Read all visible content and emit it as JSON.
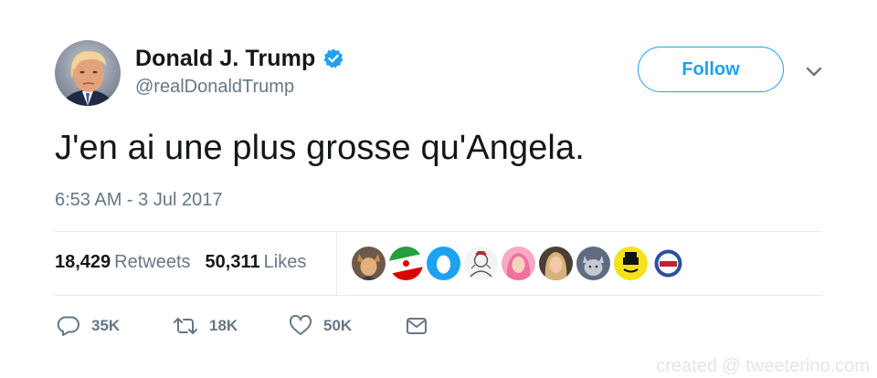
{
  "author": {
    "display_name": "Donald J. Trump",
    "handle": "@realDonaldTrump",
    "verified": true,
    "verified_color": "#1da1f2"
  },
  "follow_button": {
    "label": "Follow",
    "color": "#1da1f2"
  },
  "tweet": {
    "text": "J'en ai une plus grosse qu'Angela.",
    "timestamp": "6:53 AM - 3 Jul 2017"
  },
  "stats": {
    "retweets_count": "18,429",
    "retweets_label": "Retweets",
    "likes_count": "50,311",
    "likes_label": "Likes"
  },
  "likers": [
    {
      "name": "liker-avatar-fox-costume",
      "color": "#8a6a4f"
    },
    {
      "name": "liker-avatar-iran-flag",
      "color": "#d9362b"
    },
    {
      "name": "liker-avatar-blue-egg",
      "color": "#1da1f2"
    },
    {
      "name": "liker-avatar-sketch",
      "color": "#d8d8d8"
    },
    {
      "name": "liker-avatar-pink-hair",
      "color": "#f27aa6"
    },
    {
      "name": "liker-avatar-blonde-woman",
      "color": "#c9a07a"
    },
    {
      "name": "liker-avatar-cat",
      "color": "#7d8aa0"
    },
    {
      "name": "liker-avatar-yellow-face",
      "color": "#f4e21a"
    },
    {
      "name": "liker-avatar-trump-badge",
      "color": "#2e4f9e"
    }
  ],
  "actions": {
    "reply_count": "35K",
    "retweet_count": "18K",
    "like_count": "50K",
    "icons": [
      "reply-icon",
      "retweet-icon",
      "heart-icon",
      "envelope-icon"
    ]
  },
  "watermark": "created @ tweeterino.com",
  "colors": {
    "text_primary": "#14171a",
    "text_secondary": "#657786",
    "accent": "#1da1f2",
    "divider": "#e6ecf0"
  }
}
